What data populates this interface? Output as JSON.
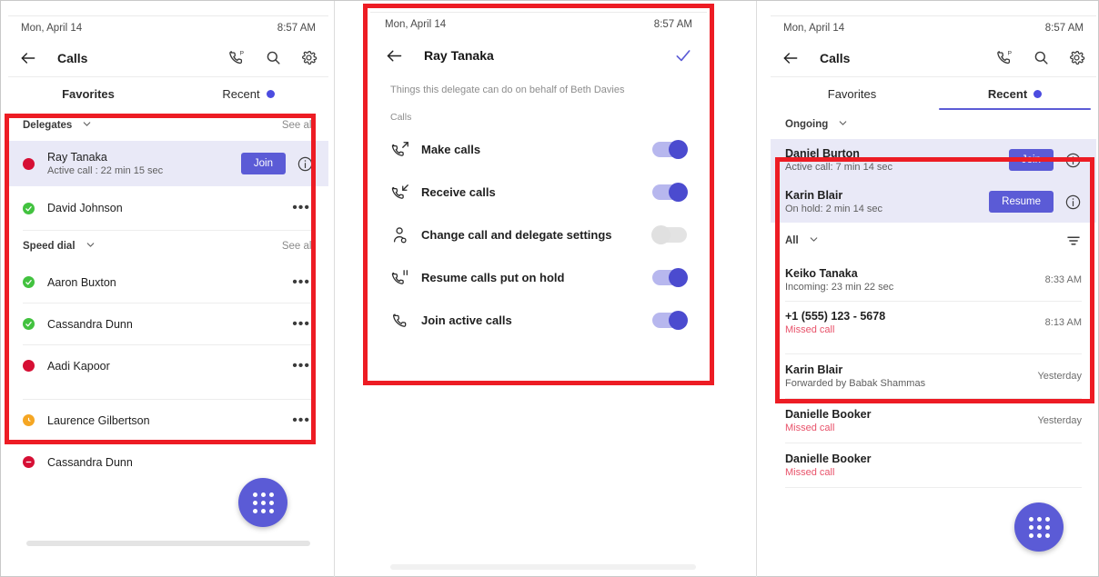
{
  "panels": {
    "left": {
      "statusbar": {
        "date": "Mon, April 14",
        "time": "8:57 AM"
      },
      "header": {
        "title": "Calls",
        "back_icon": "back-arrow-icon",
        "parked_calls_icon": "parked-calls-icon",
        "search_icon": "search-icon",
        "settings_icon": "gear-icon"
      },
      "tabs": [
        {
          "label": "Favorites",
          "active": true,
          "badge": false
        },
        {
          "label": "Recent",
          "active": false,
          "badge": true
        }
      ],
      "sections": [
        {
          "label": "Delegates",
          "see_all": "See all",
          "rows": [
            {
              "name": "Ray Tanaka",
              "sub": "Active call : 22 min 15 sec",
              "presence": "busy",
              "highlight": true,
              "action": "Join",
              "info": true
            },
            {
              "name": "David Johnson",
              "sub": "",
              "presence": "available",
              "highlight": false,
              "action": "",
              "more": "•••"
            }
          ]
        },
        {
          "label": "Speed dial",
          "see_all": "See all",
          "rows": [
            {
              "name": "Aaron Buxton",
              "sub": "",
              "presence": "available",
              "more": "•••"
            },
            {
              "name": "Cassandra Dunn",
              "sub": "",
              "presence": "available",
              "more": "•••"
            },
            {
              "name": "Aadi Kapoor",
              "sub": "",
              "presence": "busy",
              "more": "•••"
            },
            {
              "name": "Laurence Gilbertson",
              "sub": "",
              "presence": "away",
              "more": "•••"
            },
            {
              "name": "Cassandra Dunn",
              "sub": "",
              "presence": "dnd",
              "more": "•••"
            }
          ]
        }
      ],
      "fab_icon": "dialpad-icon"
    },
    "middle": {
      "statusbar": {
        "date": "Mon, April 14",
        "time": "8:57 AM"
      },
      "header": {
        "title": "Ray Tanaka",
        "back_icon": "back-arrow-icon",
        "confirm_icon": "checkmark-icon"
      },
      "description": "Things this delegate can do on behalf of Beth Davies",
      "group_caption": "Calls",
      "permissions": [
        {
          "label": "Make calls",
          "icon": "outgoing-call-icon",
          "on": true
        },
        {
          "label": "Receive calls",
          "icon": "incoming-call-icon",
          "on": true
        },
        {
          "label": "Change call and delegate settings",
          "icon": "person-settings-icon",
          "on": false
        },
        {
          "label": "Resume calls put on hold",
          "icon": "call-hold-icon",
          "on": true
        },
        {
          "label": "Join active calls",
          "icon": "phone-icon",
          "on": true
        }
      ]
    },
    "right": {
      "statusbar": {
        "date": "Mon, April 14",
        "time": "8:57 AM"
      },
      "header": {
        "title": "Calls",
        "back_icon": "back-arrow-icon",
        "parked_calls_icon": "parked-calls-icon",
        "search_icon": "search-icon",
        "settings_icon": "gear-icon"
      },
      "tabs": [
        {
          "label": "Favorites",
          "active": false,
          "badge": false
        },
        {
          "label": "Recent",
          "active": true,
          "badge": true
        }
      ],
      "ongoing": {
        "label": "Ongoing",
        "rows": [
          {
            "name": "Daniel Burton",
            "sub": "Active call: 7 min 14 sec",
            "action": "Join",
            "info": true
          },
          {
            "name": "Karin Blair",
            "sub": "On hold: 2 min 14 sec",
            "action": "Resume",
            "info": true
          }
        ]
      },
      "filter": {
        "label": "All",
        "filter_icon": "filter-icon"
      },
      "history": [
        {
          "name": "Keiko Tanaka",
          "sub": "Incoming: 23 min 22 sec",
          "missed": false,
          "time": "8:33 AM"
        },
        {
          "name": "+1 (555) 123 - 5678",
          "sub": "Missed call",
          "missed": true,
          "time": "8:13 AM"
        },
        {
          "name": "Karin Blair",
          "sub": "Forwarded by Babak Shammas",
          "missed": false,
          "time": "Yesterday"
        },
        {
          "name": "Danielle Booker",
          "sub": "Missed call",
          "missed": true,
          "time": "Yesterday"
        },
        {
          "name": "Danielle Booker",
          "sub": "Missed call",
          "missed": true,
          "time": ""
        }
      ],
      "fab_icon": "dialpad-icon"
    }
  },
  "annotations": {
    "highlight_color": "#ed1c24",
    "boxes": [
      {
        "name": "delegates-and-speed-dial-highlight"
      },
      {
        "name": "delegate-permissions-highlight"
      },
      {
        "name": "ongoing-and-recent-calls-highlight"
      }
    ]
  },
  "theme": {
    "accent": "#5b5bd6",
    "available": "#42c23f",
    "busy": "#d60f34",
    "away": "#f5a623",
    "missed": "#e8526a",
    "highlight_row": "#e9e9f7"
  }
}
